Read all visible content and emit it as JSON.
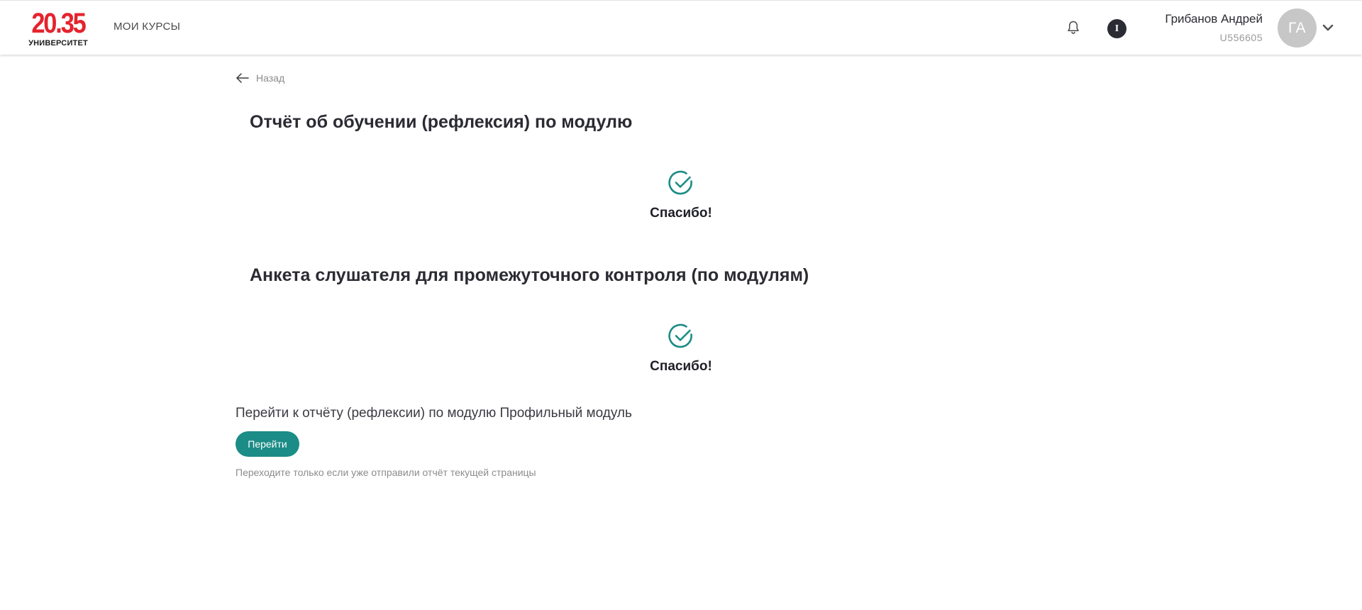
{
  "header": {
    "logo": {
      "number": "20.35",
      "subtitle": "УНИВЕРСИТЕТ"
    },
    "nav": {
      "my_courses": "МОИ КУРСЫ"
    },
    "info_badge": "I",
    "user": {
      "name": "Грибанов Андрей",
      "id": "U556605",
      "initials": "ГА"
    },
    "icons": {
      "notifications": "bell-icon",
      "menu": "chevron-down-icon"
    }
  },
  "back": {
    "label": "Назад",
    "icon": "arrow-left-icon"
  },
  "sections": [
    {
      "title": "Отчёт об обучении (рефлексия) по модулю",
      "status": "Спасибо!",
      "icon": "check-circle-icon"
    },
    {
      "title": "Анкета слушателя для промежуточного контроля (по модулям)",
      "status": "Спасибо!",
      "icon": "check-circle-icon"
    }
  ],
  "next": {
    "text": "Перейти к отчёту (рефлексии) по модулю Профильный модуль",
    "button_label": "Перейти",
    "hint": "Переходите только если уже отправили отчёт текущей страницы"
  },
  "colors": {
    "brand_red": "#e5232d",
    "accent_teal": "#1b8c86",
    "text_dark": "#2b2b33",
    "text_muted": "#8c8c8c",
    "avatar_bg": "#c7c7c7"
  }
}
